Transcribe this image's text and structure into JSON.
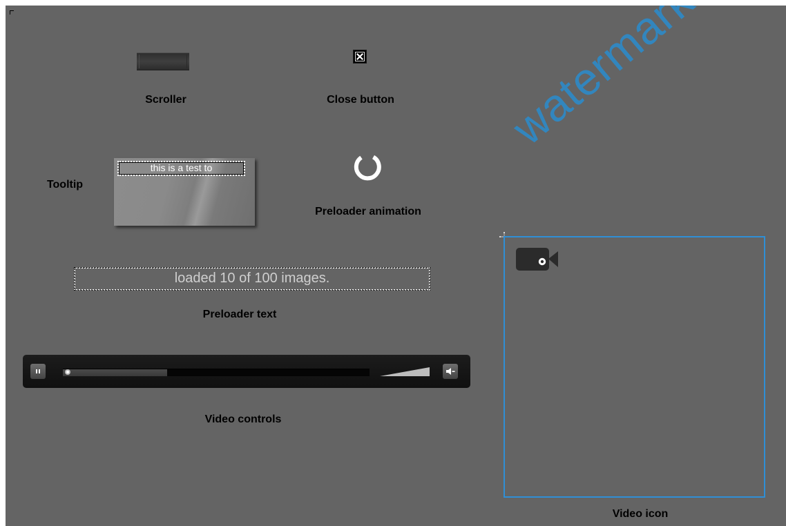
{
  "labels": {
    "scroller": "Scroller",
    "close_button": "Close button",
    "tooltip": "Tooltip",
    "preloader_animation": "Preloader animation",
    "preloader_text": "Preloader text",
    "video_controls": "Video controls",
    "video_icon": "Video icon"
  },
  "tooltip": {
    "text": "this is a test to"
  },
  "preloader": {
    "text": "loaded 10 of 100 images."
  },
  "video_controls": {
    "progress": 0.34
  },
  "watermark": {
    "text": "watermark"
  },
  "colors": {
    "background": "#646464",
    "frame_accent": "#2f8fd6",
    "watermark": "#2d8ac8"
  },
  "icons": {
    "close": "close-icon",
    "pause": "pause-icon",
    "volume": "volume-icon",
    "camera": "video-camera-icon",
    "spinner": "spinner-icon"
  }
}
